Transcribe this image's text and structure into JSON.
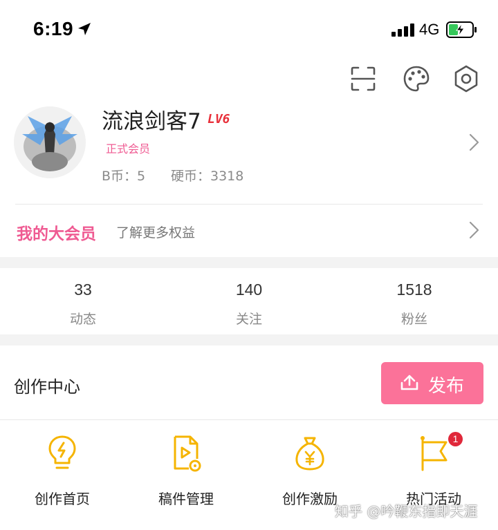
{
  "status_bar": {
    "time": "6:19",
    "network": "4G"
  },
  "profile": {
    "username": "流浪剑客7",
    "level": "LV6",
    "membership": "正式会员",
    "b_coin": "B币：5",
    "hard_coin": "硬币：3318"
  },
  "vip": {
    "title": "我的大会员",
    "subtitle": "了解更多权益"
  },
  "stats": [
    {
      "value": "33",
      "label": "动态"
    },
    {
      "value": "140",
      "label": "关注"
    },
    {
      "value": "1518",
      "label": "粉丝"
    }
  ],
  "creator": {
    "title": "创作中心",
    "publish_label": "发布",
    "tools": [
      {
        "label": "创作首页",
        "icon": "bulb-icon"
      },
      {
        "label": "稿件管理",
        "icon": "video-file-icon"
      },
      {
        "label": "创作激励",
        "icon": "money-bag-icon"
      },
      {
        "label": "热门活动",
        "icon": "flag-icon",
        "badge": "1"
      }
    ]
  },
  "watermark": "知乎 @吟鞭东指即天涯",
  "colors": {
    "accent_pink": "#fb7299",
    "icon_yellow": "#f5b400",
    "level_red": "#e8303a"
  }
}
